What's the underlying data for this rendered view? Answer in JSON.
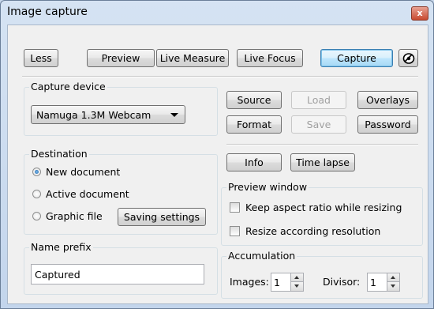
{
  "window": {
    "title": "Image capture",
    "close_glyph": "x"
  },
  "toolbar": {
    "less": "Less",
    "preview": "Preview",
    "live_measure": "Live Measure",
    "live_focus": "Live Focus",
    "capture": "Capture",
    "settings_icon": "lens-icon"
  },
  "capture_device": {
    "label": "Capture device",
    "selected": "Namuga 1.3M Webcam",
    "buttons": {
      "source": "Source",
      "load": "Load",
      "overlays": "Overlays",
      "format": "Format",
      "save": "Save",
      "password": "Password"
    }
  },
  "destination": {
    "label": "Destination",
    "options": [
      {
        "label": "New document",
        "selected": true
      },
      {
        "label": "Active document",
        "selected": false
      },
      {
        "label": "Graphic file",
        "selected": false
      }
    ],
    "saving_settings": "Saving settings"
  },
  "actions": {
    "info": "Info",
    "time_lapse": "Time lapse"
  },
  "preview_window": {
    "label": "Preview window",
    "keep_aspect": "Keep aspect ratio while resizing",
    "resize_resolution": "Resize according resolution"
  },
  "name_prefix": {
    "label": "Name prefix",
    "value": "Captured"
  },
  "accumulation": {
    "label": "Accumulation",
    "images_label": "Images:",
    "images_value": "1",
    "divisor_label": "Divisor:",
    "divisor_value": "1"
  }
}
